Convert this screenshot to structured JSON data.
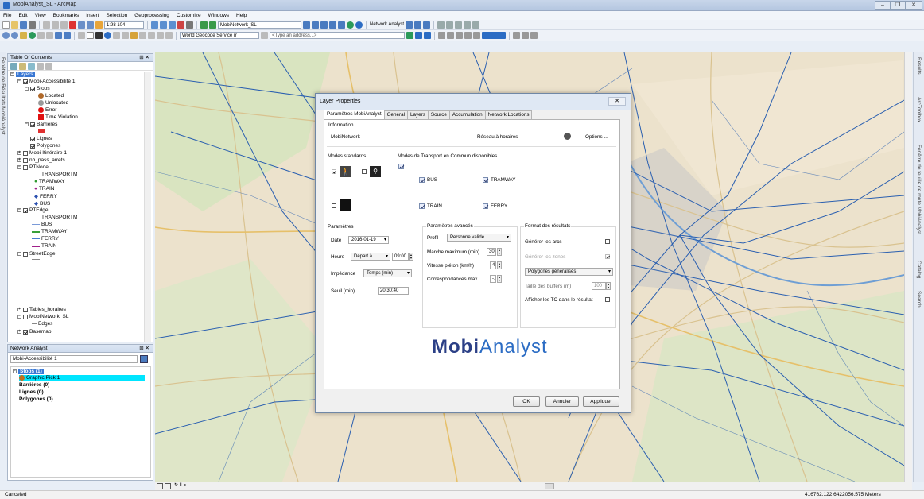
{
  "window": {
    "title": "MobiAnalyst_SL - ArcMap"
  },
  "menu": [
    "File",
    "Edit",
    "View",
    "Bookmarks",
    "Insert",
    "Selection",
    "Geoprocessing",
    "Customize",
    "Windows",
    "Help"
  ],
  "toolbar": {
    "scale": "1:98 104",
    "network_layer": "MobiNetwork_SL",
    "network_analyst_label": "Network Analyst",
    "geocode_service": "World Geocode Service (r",
    "address_placeholder": "<Type an address...>"
  },
  "left_side_tab": "Fenêtre de Résultats MobiAnalyst",
  "right_side_tabs": [
    "Results",
    "ArcToolbox",
    "Fenêtre de feuille de route MobiAnalyst",
    "Catalog",
    "Search"
  ],
  "toc": {
    "title": "Table Of Contents",
    "root": "Layers",
    "layer_main": "Mobi-Accessibilité 1",
    "stops": "Stops",
    "stops_legend": [
      "Located",
      "Unlocated",
      "Error",
      "Time Violation"
    ],
    "barrieres": "Barrières",
    "lignes": "Lignes",
    "polygones": "Polygones",
    "mobi_itineraire": "Mobi-Itinéraire 1",
    "nb_pass": "nb_pass_arrets",
    "ptnode": "PTNode",
    "ptnode_field": "TRANSPORTM",
    "ptnode_items": [
      "TRAMWAY",
      "TRAIN",
      "FERRY",
      "BUS"
    ],
    "ptedge": "PTEdge",
    "ptedge_field": "TRANSPORTM",
    "ptedge_items": [
      "BUS",
      "TRAMWAY",
      "FERRY",
      "TRAIN"
    ],
    "streetedge": "StreetEdge",
    "tables_horaires": "Tables_horaires",
    "mobinetwork": "MobiNetwork_SL",
    "edges": "Edges",
    "basemap": "Basemap"
  },
  "network_analyst": {
    "title": "Network Analyst",
    "layer": "Mobi-Accessibilité 1",
    "stops": "Stops (1)",
    "graphic_pick": "Graphic Pick 1",
    "barrieres": "Barrières (0)",
    "lignes": "Lignes (0)",
    "polygones": "Polygones (0)"
  },
  "dialog": {
    "title": "Layer Properties",
    "close": "✕",
    "tabs": [
      "Paramètres MobiAnalyst",
      "General",
      "Layers",
      "Source",
      "Accumulation",
      "Network Locations"
    ],
    "info": {
      "label": "Information",
      "network": "MobiNetwork",
      "type": "Réseau à horaires",
      "options": "Options ..."
    },
    "modes_standards": "Modes standards",
    "modes_tc": "Modes de Transport en Commun disponibles",
    "tc_modes": [
      "BUS",
      "TRAMWAY",
      "TRAIN",
      "FERRY"
    ],
    "params": {
      "label": "Paramètres",
      "date_label": "Date",
      "date": "2016-01-19",
      "heure_label": "Heure",
      "heure_mode": "Départ à",
      "heure": "09:00",
      "impedance_label": "Impédance",
      "impedance": "Temps (min)",
      "seuil_label": "Seuil (min)",
      "seuil": "20;30;40"
    },
    "adv": {
      "label": "Paramètres avancés",
      "profil_label": "Profil",
      "profil": "Personne valide",
      "marche_label": "Marche maximum (min)",
      "marche": "30",
      "vitesse_label": "Vitesse piéton (km/h)",
      "vitesse": "4",
      "corresp_label": "Correspondances max",
      "corresp": "-1"
    },
    "format": {
      "label": "Format des résultats",
      "arcs": "Générer les arcs",
      "zones": "Générer les zones",
      "poly": "Polygones généralisés",
      "buffer_label": "Taille des buffers (m)",
      "buffer": "100",
      "afficher": "Afficher les TC dans le résultat"
    },
    "logo_bold": "Mobi",
    "logo_light": "Analyst",
    "buttons": {
      "ok": "OK",
      "annuler": "Annuler",
      "appliquer": "Appliquer"
    }
  },
  "status": {
    "left": "Canceled",
    "coords": "416762.122  6422056.575 Meters"
  },
  "colors": {
    "accent": "#2b6cc4",
    "network_line": "#2a5fb0",
    "logo": "#2b3f86"
  }
}
